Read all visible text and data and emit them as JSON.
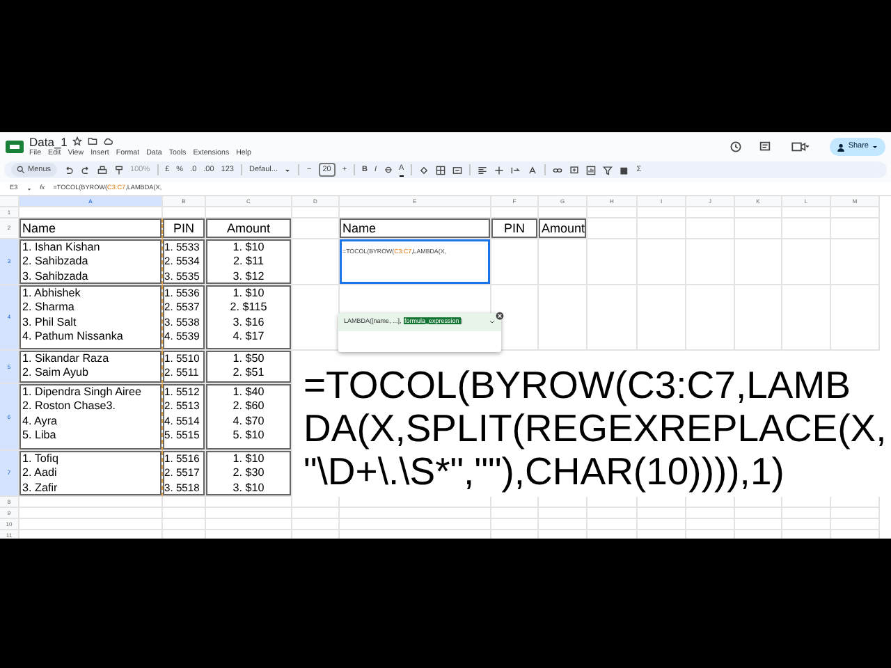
{
  "document": {
    "title": "Data_1"
  },
  "menu": [
    "File",
    "Edit",
    "View",
    "Insert",
    "Format",
    "Data",
    "Tools",
    "Extensions",
    "Help"
  ],
  "share": "Share",
  "toolbar": {
    "search": "Menus",
    "zoom": "100%",
    "currency": "£",
    "percent": "%",
    "decrease_decimal": ".0",
    "increase_decimal": ".00",
    "number_format": "123",
    "font": "Defaul...",
    "font_size_minus": "−",
    "font_size": "20",
    "font_size_plus": "+",
    "bold": "B",
    "italic": "I",
    "text_color": "A",
    "sum": "Σ"
  },
  "formula_bar": {
    "cell": "E3",
    "fx": "fx",
    "parts": [
      {
        "text": "=TOCOL(BYROW(",
        "kind": "plain"
      },
      {
        "text": "C3:C7",
        "kind": "range"
      },
      {
        "text": ",LAMBDA(X,",
        "kind": "plain"
      }
    ]
  },
  "columns": [
    {
      "label": "A",
      "selected": true
    },
    {
      "label": "B",
      "selected": false
    },
    {
      "label": "C",
      "selected": false
    },
    {
      "label": "D",
      "selected": false
    },
    {
      "label": "E",
      "selected": false
    },
    {
      "label": "F",
      "selected": false
    },
    {
      "label": "G",
      "selected": false
    },
    {
      "label": "H",
      "selected": false
    },
    {
      "label": "I",
      "selected": false
    },
    {
      "label": "J",
      "selected": false
    },
    {
      "label": "K",
      "selected": false
    },
    {
      "label": "L",
      "selected": false
    },
    {
      "label": "M",
      "selected": false
    }
  ],
  "row_numbers": [
    {
      "label": "1",
      "selected": false
    },
    {
      "label": "2",
      "selected": false
    },
    {
      "label": "3",
      "selected": true
    },
    {
      "label": "4",
      "selected": true
    },
    {
      "label": "5",
      "selected": true
    },
    {
      "label": "6",
      "selected": true
    },
    {
      "label": "7",
      "selected": true
    },
    {
      "label": "8",
      "selected": false
    },
    {
      "label": "9",
      "selected": false
    },
    {
      "label": "10",
      "selected": false
    },
    {
      "label": "11",
      "selected": false
    }
  ],
  "table": {
    "header": [
      "Name",
      "PIN",
      "Amount"
    ],
    "rows": [
      {
        "names": [
          "1. Ishan Kishan",
          "2. Sahibzada",
          "3. Sahibzada"
        ],
        "pins": [
          "1. 5533",
          "2. 5534",
          "3. 5535"
        ],
        "amounts": [
          "1. $10",
          "2. $11",
          "3. $12"
        ]
      },
      {
        "names": [
          "1. Abhishek",
          "2. Sharma",
          "3. Phil Salt",
          "4. Pathum Nissanka"
        ],
        "pins": [
          "1. 5536",
          "2. 5537",
          "3. 5538",
          "4. 5539"
        ],
        "amounts": [
          "1. $10",
          "2. $115",
          "3. $16",
          "4. $17"
        ]
      },
      {
        "names": [
          "1. Sikandar Raza",
          "2. Saim Ayub"
        ],
        "pins": [
          "1. 5510",
          "2. 5511"
        ],
        "amounts": [
          "1. $50",
          "2. $51"
        ]
      },
      {
        "names": [
          "1. Dipendra Singh Airee",
          "2. Roston Chase3.",
          "4. Ayra",
          "5. Liba"
        ],
        "pins": [
          "1. 5512",
          "2. 5513",
          "4. 5514",
          "5. 5515"
        ],
        "amounts": [
          "1. $40",
          "2. $60",
          "4. $70",
          "5. $10"
        ]
      },
      {
        "names": [
          "1. Tofiq",
          "2. Aadi",
          "3. Zafir"
        ],
        "pins": [
          "1. 5516",
          "2. 5517",
          "3. 5518"
        ],
        "amounts": [
          "1. $10",
          "2. $30",
          "3. $10"
        ]
      }
    ]
  },
  "result_header": [
    "Name",
    "PIN",
    "Amount"
  ],
  "editor": {
    "parts": [
      {
        "text": "=TOCOL(BYROW(",
        "kind": "plain"
      },
      {
        "text": "C3:C7",
        "kind": "range"
      },
      {
        "text": ",LAMBDA(X,",
        "kind": "plain"
      }
    ],
    "hint_prefix": "LAMBDA([name, ...], ",
    "hint_current": "formula_expression",
    "hint_suffix": ")"
  },
  "overlay_formula_lines": [
    "=TOCOL(BYROW(C3:C7,LAMB",
    "DA(X,SPLIT(REGEXREPLACE(X,",
    "\"\\D+\\.\\S*\",\"\"),CHAR(10)))),1)"
  ]
}
